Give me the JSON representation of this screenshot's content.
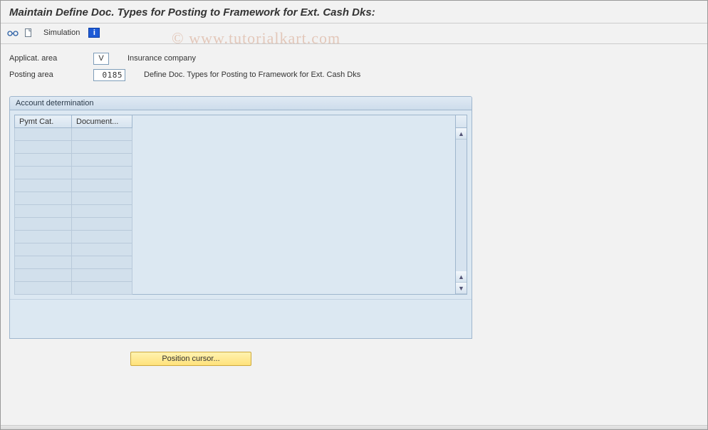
{
  "title": "Maintain Define Doc. Types for Posting to Framework for Ext. Cash Dks:",
  "toolbar": {
    "simulation_label": "Simulation",
    "info_glyph": "i"
  },
  "fields": {
    "applicat_area": {
      "label": "Applicat. area",
      "value": "V",
      "desc": "Insurance company"
    },
    "posting_area": {
      "label": "Posting area",
      "value": "0185",
      "desc": "Define Doc. Types for Posting to Framework for Ext. Cash Dks"
    }
  },
  "panel": {
    "header": "Account determination",
    "columns": [
      "Pymt Cat.",
      "Document..."
    ],
    "row_count": 13
  },
  "buttons": {
    "position_cursor": "Position cursor..."
  },
  "watermark": "© www.tutorialkart.com"
}
